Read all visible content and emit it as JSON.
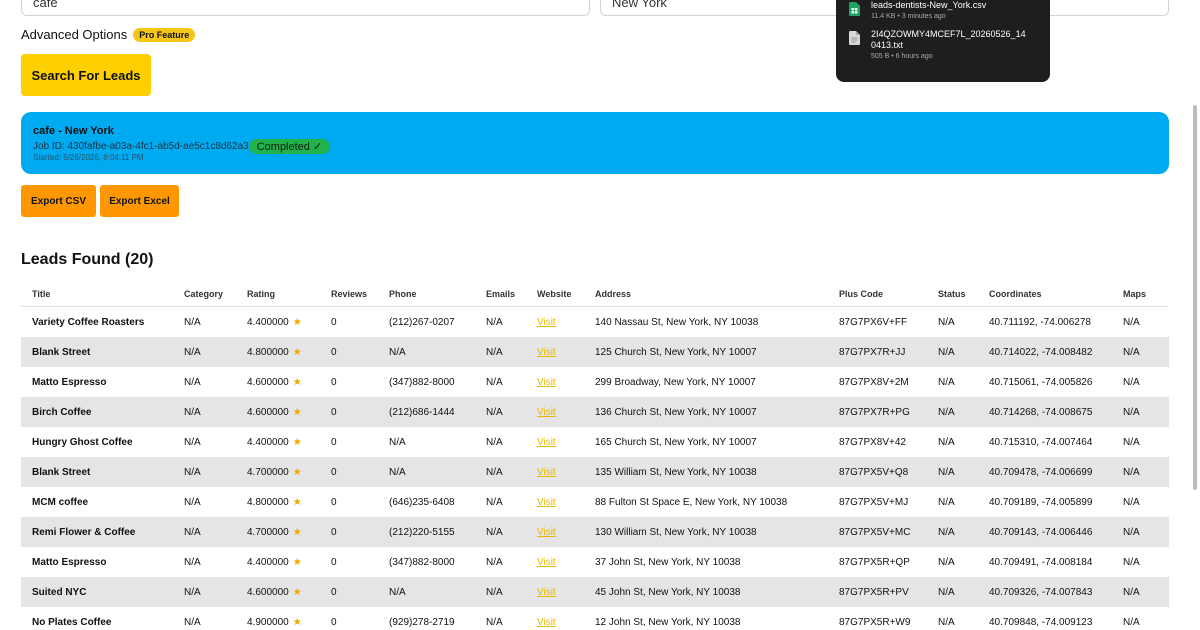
{
  "search": {
    "keyword_value": "cafe",
    "location_value": "New York",
    "advanced_label": "Advanced Options",
    "pro_badge": "Pro Feature",
    "search_button": "Search For Leads"
  },
  "job": {
    "title": "cafe - New York",
    "job_id": "Job ID: 430fafbe-a03a-4fc1-ab5d-ae5c1c8d62a3",
    "status": "Completed ✓",
    "started": "Started: 5/26/2026, 8:04:11 PM"
  },
  "export": {
    "csv_label": "Export CSV",
    "excel_label": "Export Excel"
  },
  "leads": {
    "heading": "Leads Found (20)",
    "columns": [
      "Title",
      "Category",
      "Rating",
      "Reviews",
      "Phone",
      "Emails",
      "Website",
      "Address",
      "Plus Code",
      "Status",
      "Coordinates",
      "Maps"
    ],
    "rows": [
      {
        "title": "Variety Coffee Roasters",
        "category": "N/A",
        "rating": "4.400000",
        "reviews": "0",
        "phone": "(212)267-0207",
        "emails": "N/A",
        "website": "Visit",
        "address": "140 Nassau St, New York, NY 10038",
        "plus_code": "87G7PX6V+FF",
        "status": "N/A",
        "coordinates": "40.711192, -74.006278",
        "maps": "N/A"
      },
      {
        "title": "Blank Street",
        "category": "N/A",
        "rating": "4.800000",
        "reviews": "0",
        "phone": "N/A",
        "emails": "N/A",
        "website": "Visit",
        "address": "125 Church St, New York, NY 10007",
        "plus_code": "87G7PX7R+JJ",
        "status": "N/A",
        "coordinates": "40.714022, -74.008482",
        "maps": "N/A"
      },
      {
        "title": "Matto Espresso",
        "category": "N/A",
        "rating": "4.600000",
        "reviews": "0",
        "phone": "(347)882-8000",
        "emails": "N/A",
        "website": "Visit",
        "address": "299 Broadway, New York, NY 10007",
        "plus_code": "87G7PX8V+2M",
        "status": "N/A",
        "coordinates": "40.715061, -74.005826",
        "maps": "N/A"
      },
      {
        "title": "Birch Coffee",
        "category": "N/A",
        "rating": "4.600000",
        "reviews": "0",
        "phone": "(212)686-1444",
        "emails": "N/A",
        "website": "Visit",
        "address": "136 Church St, New York, NY 10007",
        "plus_code": "87G7PX7R+PG",
        "status": "N/A",
        "coordinates": "40.714268, -74.008675",
        "maps": "N/A"
      },
      {
        "title": "Hungry Ghost Coffee",
        "category": "N/A",
        "rating": "4.400000",
        "reviews": "0",
        "phone": "N/A",
        "emails": "N/A",
        "website": "Visit",
        "address": "165 Church St, New York, NY 10007",
        "plus_code": "87G7PX8V+42",
        "status": "N/A",
        "coordinates": "40.715310, -74.007464",
        "maps": "N/A"
      },
      {
        "title": "Blank Street",
        "category": "N/A",
        "rating": "4.700000",
        "reviews": "0",
        "phone": "N/A",
        "emails": "N/A",
        "website": "Visit",
        "address": "135 William St, New York, NY 10038",
        "plus_code": "87G7PX5V+Q8",
        "status": "N/A",
        "coordinates": "40.709478, -74.006699",
        "maps": "N/A"
      },
      {
        "title": "MCM coffee",
        "category": "N/A",
        "rating": "4.800000",
        "reviews": "0",
        "phone": "(646)235-6408",
        "emails": "N/A",
        "website": "Visit",
        "address": "88 Fulton St Space E, New York, NY 10038",
        "plus_code": "87G7PX5V+MJ",
        "status": "N/A",
        "coordinates": "40.709189, -74.005899",
        "maps": "N/A"
      },
      {
        "title": "Remi Flower & Coffee",
        "category": "N/A",
        "rating": "4.700000",
        "reviews": "0",
        "phone": "(212)220-5155",
        "emails": "N/A",
        "website": "Visit",
        "address": "130 William St, New York, NY 10038",
        "plus_code": "87G7PX5V+MC",
        "status": "N/A",
        "coordinates": "40.709143, -74.006446",
        "maps": "N/A"
      },
      {
        "title": "Matto Espresso",
        "category": "N/A",
        "rating": "4.400000",
        "reviews": "0",
        "phone": "(347)882-8000",
        "emails": "N/A",
        "website": "Visit",
        "address": "37 John St, New York, NY 10038",
        "plus_code": "87G7PX5R+QP",
        "status": "N/A",
        "coordinates": "40.709491, -74.008184",
        "maps": "N/A"
      },
      {
        "title": "Suited NYC",
        "category": "N/A",
        "rating": "4.600000",
        "reviews": "0",
        "phone": "N/A",
        "emails": "N/A",
        "website": "Visit",
        "address": "45 John St, New York, NY 10038",
        "plus_code": "87G7PX5R+PV",
        "status": "N/A",
        "coordinates": "40.709326, -74.007843",
        "maps": "N/A"
      },
      {
        "title": "No Plates Coffee",
        "category": "N/A",
        "rating": "4.900000",
        "reviews": "0",
        "phone": "(929)278-2719",
        "emails": "N/A",
        "website": "Visit",
        "address": "12 John St, New York, NY 10038",
        "plus_code": "87G7PX5R+W9",
        "status": "N/A",
        "coordinates": "40.709848, -74.009123",
        "maps": "N/A"
      }
    ]
  },
  "downloads": {
    "items": [
      {
        "name": "leads-dentists-New_York.csv",
        "meta": "11.4 KB • 3 minutes ago",
        "icon": "spreadsheet-file-icon"
      },
      {
        "name": "2I4QZOWMY4MCEF7L_20260526_140413.txt",
        "meta": "505 B • 6 hours ago",
        "icon": "text-file-icon"
      }
    ]
  },
  "colors": {
    "accent_yellow": "#ffd000",
    "job_blue": "#00aaf0",
    "status_green": "#22b24c",
    "export_orange": "#ff9800"
  }
}
